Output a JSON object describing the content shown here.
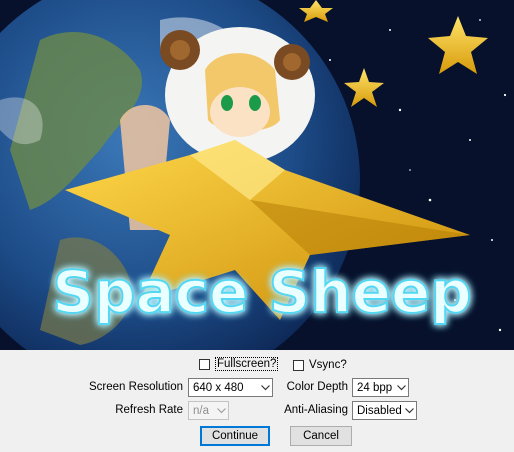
{
  "banner": {
    "title": "Space Sheep"
  },
  "options": {
    "fullscreen_label": "Fullscreen?",
    "fullscreen_checked": false,
    "vsync_label": "Vsync?",
    "vsync_checked": false,
    "screen_resolution_label": "Screen Resolution",
    "screen_resolution_value": "640 x 480",
    "refresh_rate_label": "Refresh Rate",
    "refresh_rate_value": "n/a",
    "color_depth_label": "Color Depth",
    "color_depth_value": "24 bpp",
    "anti_aliasing_label": "Anti-Aliasing",
    "anti_aliasing_value": "Disabled"
  },
  "buttons": {
    "continue_label": "Continue",
    "cancel_label": "Cancel"
  }
}
